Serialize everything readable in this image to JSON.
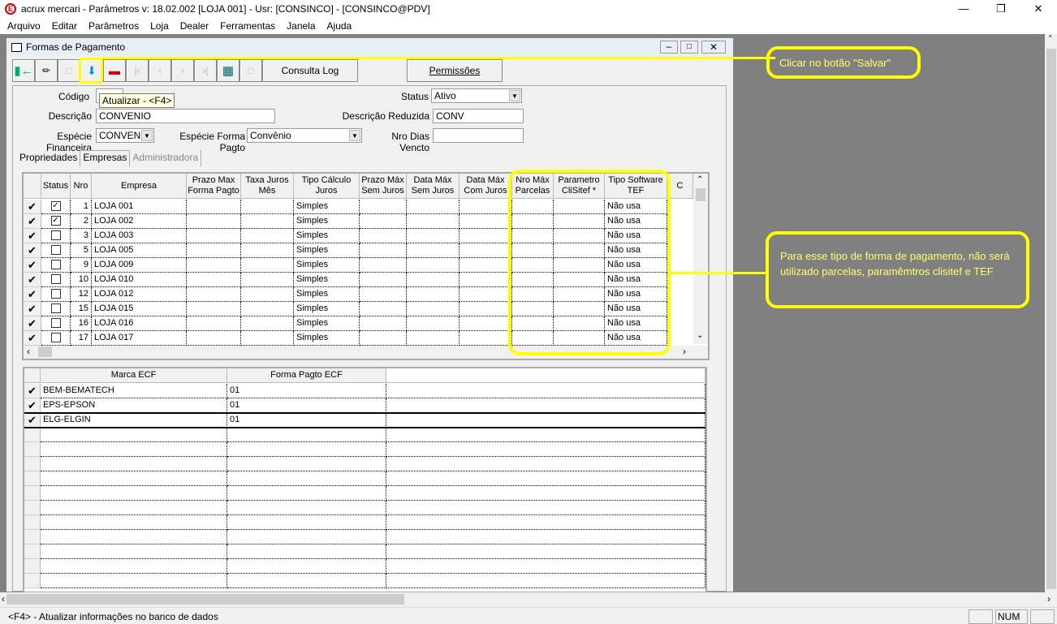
{
  "app": {
    "title": "acrux mercari - Parâmetros  v: 18.02.002   [LOJA 001] - Usr: [CONSINCO] - [CONSINCO@PDV]",
    "logo": "E"
  },
  "menu": [
    "Arquivo",
    "Editar",
    "Parâmetros",
    "Loja",
    "Dealer",
    "Ferramentas",
    "Janela",
    "Ajuda"
  ],
  "window": {
    "title": "Formas de Pagamento"
  },
  "toolbar": {
    "consulta_log": "Consulta Log",
    "permissoes": "Permissões",
    "tooltip": "Atualizar - <F4>"
  },
  "form": {
    "codigo_label": "Código",
    "codigo": "",
    "status_label": "Status",
    "status": "Ativo",
    "descricao_label": "Descrição",
    "descricao": "CONVENIO",
    "desc_reduzida_label": "Descrição Reduzida",
    "desc_reduzida": "CONV",
    "especie_fin_label": "Espécie Financeira",
    "especie_fin": "CONVEN",
    "especie_forma_label": "Espécie Forma Pagto",
    "especie_forma": "Convênio",
    "nro_dias_label": "Nro Dias Vencto",
    "nro_dias": ""
  },
  "tabs": [
    "Propriedades",
    "Empresas",
    "Administradora"
  ],
  "empresas": {
    "headers": [
      "Status",
      "Nro",
      "Empresa",
      "Prazo Max Forma Pagto",
      "Taxa Juros Mês",
      "Tipo Cálculo Juros",
      "Prazo Máx Sem Juros",
      "Data Máx Sem Juros",
      "Data Máx Com Juros",
      "Nro Máx Parcelas",
      "Parametro CliSitef *",
      "Tipo Software TEF",
      "C"
    ],
    "rows": [
      {
        "status": true,
        "nro": "1",
        "empresa": "LOJA 001",
        "tipo": "Simples",
        "tef": "Não usa"
      },
      {
        "status": true,
        "nro": "2",
        "empresa": "LOJA 002",
        "tipo": "Simples",
        "tef": "Não usa"
      },
      {
        "status": false,
        "nro": "3",
        "empresa": "LOJA 003",
        "tipo": "Simples",
        "tef": "Não usa"
      },
      {
        "status": false,
        "nro": "5",
        "empresa": "LOJA 005",
        "tipo": "Simples",
        "tef": "Não usa"
      },
      {
        "status": false,
        "nro": "9",
        "empresa": "LOJA 009",
        "tipo": "Simples",
        "tef": "Não usa"
      },
      {
        "status": false,
        "nro": "10",
        "empresa": "LOJA 010",
        "tipo": "Simples",
        "tef": "Não usa"
      },
      {
        "status": false,
        "nro": "12",
        "empresa": "LOJA 012",
        "tipo": "Simples",
        "tef": "Não usa"
      },
      {
        "status": false,
        "nro": "15",
        "empresa": "LOJA 015",
        "tipo": "Simples",
        "tef": "Não usa"
      },
      {
        "status": false,
        "nro": "16",
        "empresa": "LOJA 016",
        "tipo": "Simples",
        "tef": "Não usa"
      },
      {
        "status": false,
        "nro": "17",
        "empresa": "LOJA 017",
        "tipo": "Simples",
        "tef": "Não usa"
      }
    ]
  },
  "ecf": {
    "headers": [
      "Marca ECF",
      "Forma Pagto ECF"
    ],
    "rows": [
      [
        "BEM-BEMATECH",
        "01"
      ],
      [
        "EPS-EPSON",
        "01"
      ],
      [
        "ELG-ELGIN",
        "01"
      ]
    ]
  },
  "annotations": {
    "salvar": "Clicar no botão \"Salvar\"",
    "parcelas": "Para esse tipo de forma de pagamento, não será utilizado parcelas, paramêmtros clisitef e TEF",
    "color": "#ffff00"
  },
  "statusbar": {
    "message": "<F4> - Atualizar informações no banco de dados",
    "num": "NUM"
  }
}
